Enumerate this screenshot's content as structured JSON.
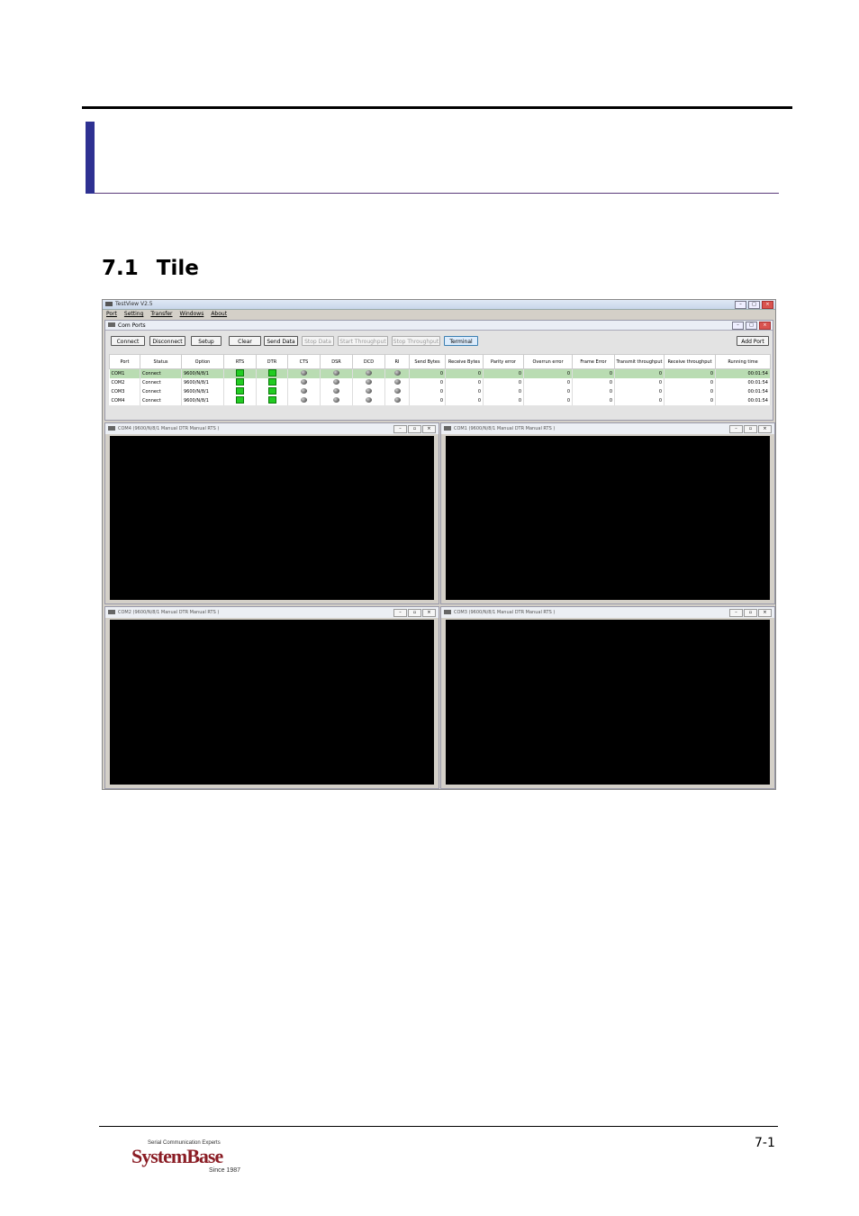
{
  "section": {
    "number": "7.1",
    "title": "Tile"
  },
  "app": {
    "title": "TestView V2.5",
    "menu": [
      "Port",
      "Setting",
      "Transfer",
      "Windows",
      "About"
    ],
    "comports": {
      "title": "Com Ports",
      "buttons": {
        "connect": "Connect",
        "disconnect": "Disconnect",
        "setup": "Setup",
        "clear": "Clear",
        "send_data": "Send Data",
        "stop_data": "Stop Data",
        "start_throughput": "Start Throughput",
        "stop_throughput": "Stop Throughput",
        "terminal": "Terminal",
        "add_port": "Add Port"
      },
      "columns": [
        "Port",
        "Status",
        "Option",
        "RTS",
        "DTR",
        "CTS",
        "DSR",
        "DCD",
        "RI",
        "Send Bytes",
        "Receive Bytes",
        "Parity error",
        "Overrun error",
        "Frame Error",
        "Transmit throughput",
        "Receive throughput",
        "Running time"
      ],
      "rows": [
        {
          "port": "COM1",
          "status": "Connect",
          "option": "9600/N/8/1",
          "send": "0",
          "receive": "0",
          "parity": "0",
          "overrun": "0",
          "frame": "0",
          "tx": "0",
          "rx": "0",
          "time": "00:01:54"
        },
        {
          "port": "COM2",
          "status": "Connect",
          "option": "9600/N/8/1",
          "send": "0",
          "receive": "0",
          "parity": "0",
          "overrun": "0",
          "frame": "0",
          "tx": "0",
          "rx": "0",
          "time": "00:01:54"
        },
        {
          "port": "COM3",
          "status": "Connect",
          "option": "9600/N/8/1",
          "send": "0",
          "receive": "0",
          "parity": "0",
          "overrun": "0",
          "frame": "0",
          "tx": "0",
          "rx": "0",
          "time": "00:01:54"
        },
        {
          "port": "COM4",
          "status": "Connect",
          "option": "9600/N/8/1",
          "send": "0",
          "receive": "0",
          "parity": "0",
          "overrun": "0",
          "frame": "0",
          "tx": "0",
          "rx": "0",
          "time": "00:01:54"
        }
      ]
    },
    "terminals": [
      {
        "title": "COM4 (9600/N/8/1  Manual DTR Manual RTS )"
      },
      {
        "title": "COM1 (9600/N/8/1  Manual DTR Manual RTS )"
      },
      {
        "title": "COM2 (9600/N/8/1  Manual DTR Manual RTS )"
      },
      {
        "title": "COM3 (9600/N/8/1  Manual DTR Manual RTS )"
      }
    ]
  },
  "footer": {
    "page": "7-1",
    "logo_tag": "Serial Communication Experts",
    "logo_brand": "SystemBase",
    "logo_since": "Since 1987"
  }
}
